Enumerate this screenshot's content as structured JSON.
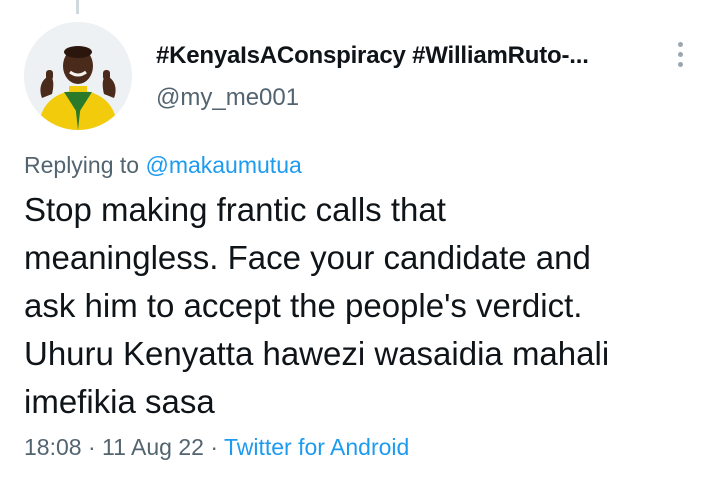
{
  "tweet": {
    "display_name": "#KenyaIsAConspiracy #WilliamRuto-...",
    "handle": "@my_me001",
    "replying_prefix": "Replying to",
    "replying_to": "@makaumutua",
    "text_lines": [
      "Stop making frantic calls that",
      "meaningless. Face your candidate and",
      "ask him to accept the people's verdict.",
      "Uhuru Kenyatta hawezi wasaidia mahali",
      "imefikia sasa"
    ],
    "time": "18:08",
    "date": "11 Aug 22",
    "separator": "·",
    "source": "Twitter for Android"
  },
  "icons": {
    "more": "more-vertical-icon",
    "avatar": "profile-photo"
  },
  "colors": {
    "link": "#1d9bf0",
    "secondary_text": "#536471",
    "primary_text": "#0f1419",
    "jersey": "#f2cc0c"
  }
}
